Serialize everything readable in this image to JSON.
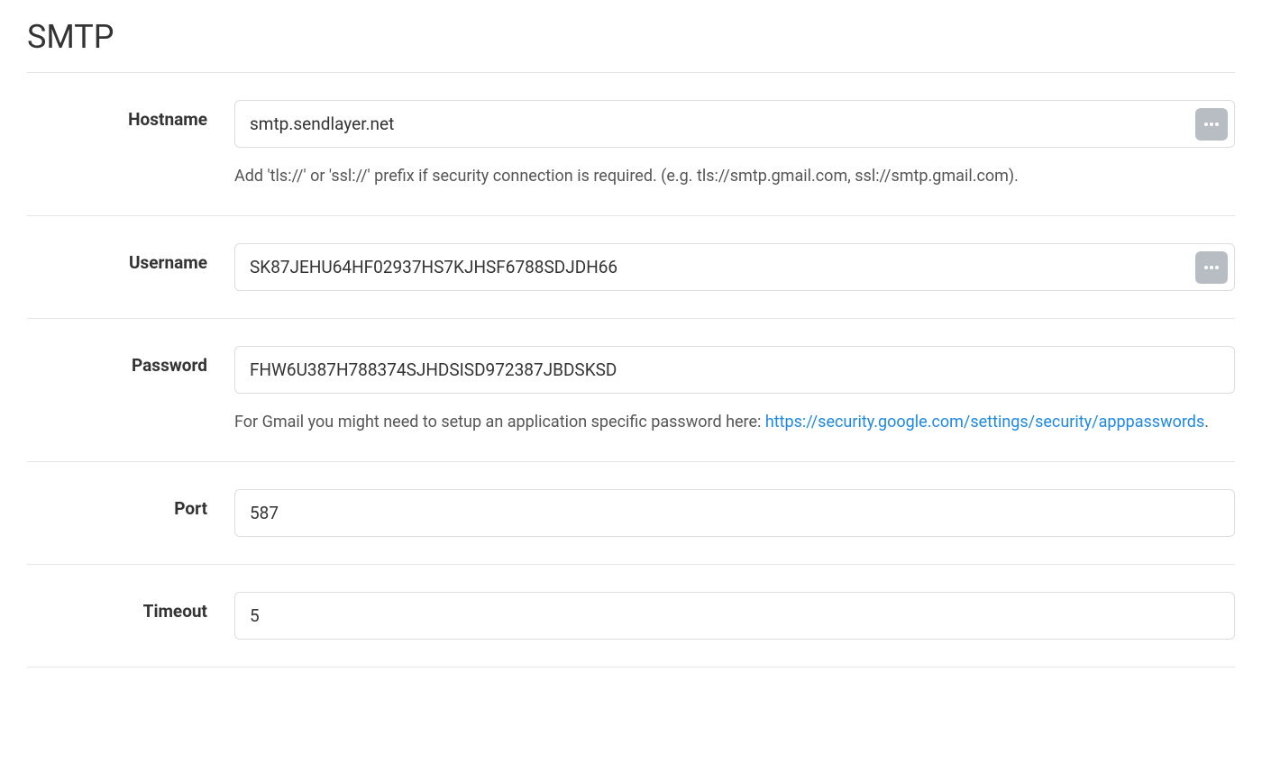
{
  "title": "SMTP",
  "fields": {
    "hostname": {
      "label": "Hostname",
      "value": "smtp.sendlayer.net",
      "help": "Add 'tls://' or 'ssl://' prefix if security connection is required. (e.g. tls://smtp.gmail.com, ssl://smtp.gmail.com)."
    },
    "username": {
      "label": "Username",
      "value": "SK87JEHU64HF02937HS7KJHSF6788SDJDH66"
    },
    "password": {
      "label": "Password",
      "value": "FHW6U387H788374SJHDSISD972387JBDSKSD",
      "help_prefix": "For Gmail you might need to setup an application specific password here: ",
      "help_link_text": "https://security.google.com/settings/security/apppasswords",
      "help_suffix": "."
    },
    "port": {
      "label": "Port",
      "value": "587"
    },
    "timeout": {
      "label": "Timeout",
      "value": "5"
    }
  }
}
